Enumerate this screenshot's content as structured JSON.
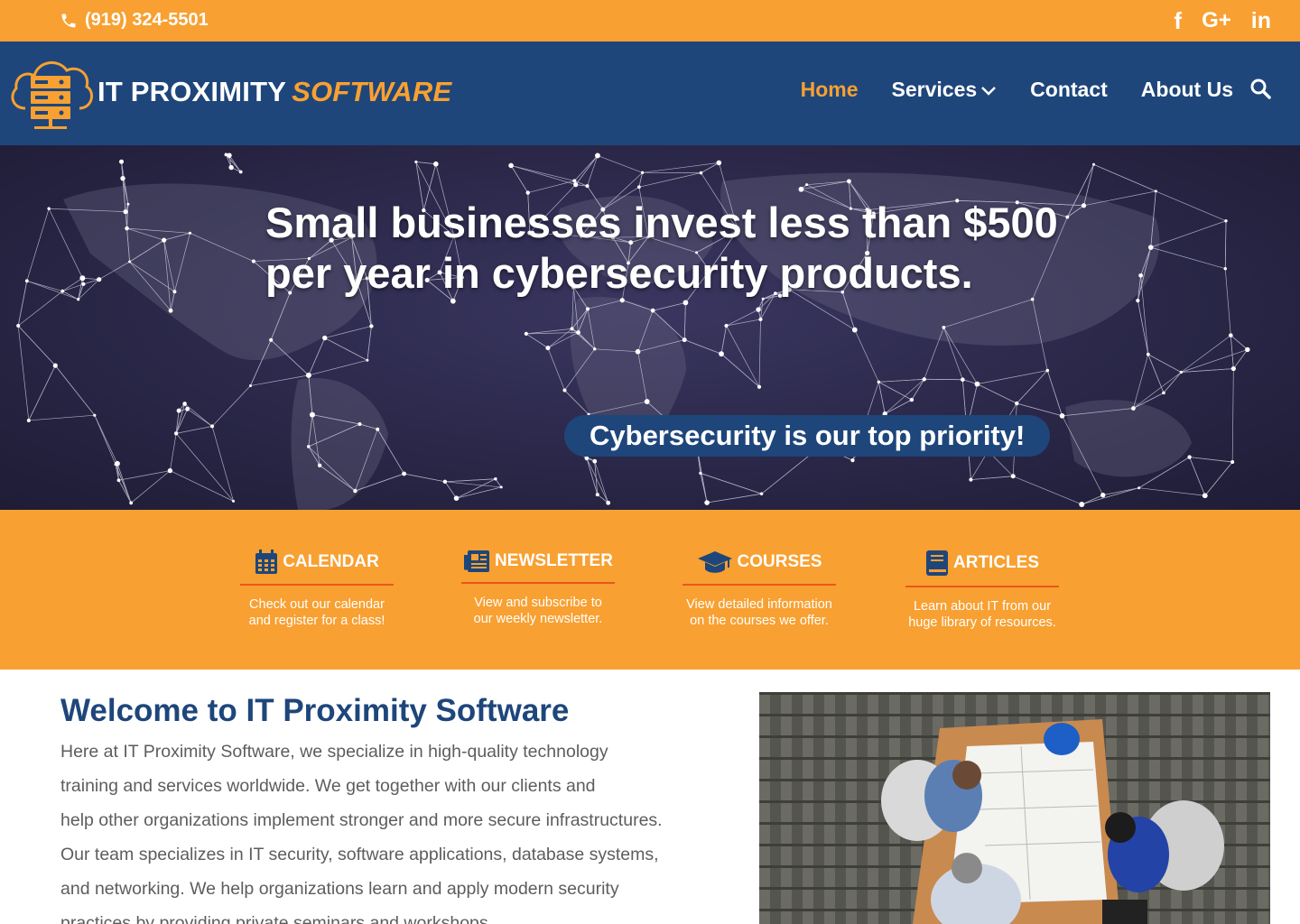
{
  "topbar": {
    "phone": "(919) 324-5501",
    "social": [
      "facebook-icon",
      "google-plus-icon",
      "linkedin-icon"
    ],
    "social_glyphs": {
      "facebook": "f",
      "google": "G+",
      "linkedin": "in"
    }
  },
  "brand": {
    "primary": "IT PROXIMITY",
    "secondary": "SOFTWARE"
  },
  "nav": {
    "items": [
      {
        "label": "Home",
        "active": true
      },
      {
        "label": "Services",
        "dropdown": true
      },
      {
        "label": "Contact"
      },
      {
        "label": "About Us"
      }
    ]
  },
  "hero": {
    "headline": "Small businesses invest less than $500 per year in cybersecurity products.",
    "tagline": "Cybersecurity is our top priority!"
  },
  "features": [
    {
      "icon": "calendar-icon",
      "title": "CALENDAR",
      "line1": "Check out our calendar",
      "line2": "and register for a class!"
    },
    {
      "icon": "newspaper-icon",
      "title": "NEWSLETTER",
      "line1": "View and subscribe to",
      "line2": "our weekly newsletter."
    },
    {
      "icon": "graduation-cap-icon",
      "title": "COURSES",
      "line1": "View detailed information",
      "line2": "on the courses we offer."
    },
    {
      "icon": "book-icon",
      "title": "ARTICLES",
      "line1": "Learn about IT from our",
      "line2": "huge library of resources."
    }
  ],
  "welcome": {
    "title": "Welcome to IT Proximity Software",
    "lines": [
      "Here at IT Proximity Software, we specialize in high-quality technology",
      "training and services worldwide.  We get together with our clients and",
      "help other organizations implement stronger and more secure infrastructures.",
      "Our team specializes in IT security, software applications, database systems,",
      "and networking.  We help organizations learn and apply modern security",
      "practices by providing private seminars and workshops."
    ]
  },
  "colors": {
    "orange": "#f8a031",
    "navy": "#1e467b",
    "underline": "#e8581a",
    "body_text": "#5d5d5d"
  }
}
